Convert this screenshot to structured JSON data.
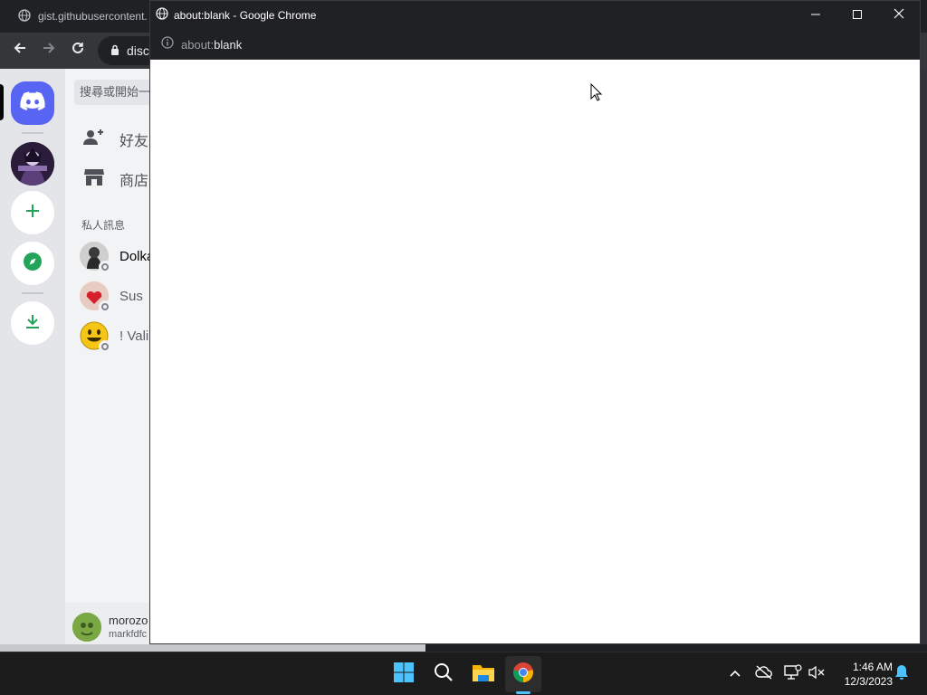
{
  "background_browser": {
    "tab_title": "gist.githubusercontent.",
    "address_fragment": "disc"
  },
  "discord": {
    "search_placeholder": "搜尋或開始一",
    "nav_items": [
      {
        "label": "好友"
      },
      {
        "label": "商店"
      }
    ],
    "dm_header": "私人訊息",
    "dms": [
      {
        "name": "Dolka"
      },
      {
        "name": "Sus"
      },
      {
        "name": "! Vali"
      }
    ],
    "user": {
      "name": "morozo",
      "tag": "markfdfc"
    }
  },
  "popup": {
    "window_title": "about:blank - Google Chrome",
    "url_prefix": "about:",
    "url_main": "blank"
  },
  "taskbar": {
    "apps": [
      "start",
      "search",
      "file-explorer",
      "chrome"
    ],
    "clock_time": "1:46 AM",
    "clock_date": "12/3/2023"
  },
  "colors": {
    "discord_blurple": "#5865f2",
    "discord_green": "#23a559",
    "chrome_dark": "#202124",
    "taskbar": "#1c1c1c"
  }
}
